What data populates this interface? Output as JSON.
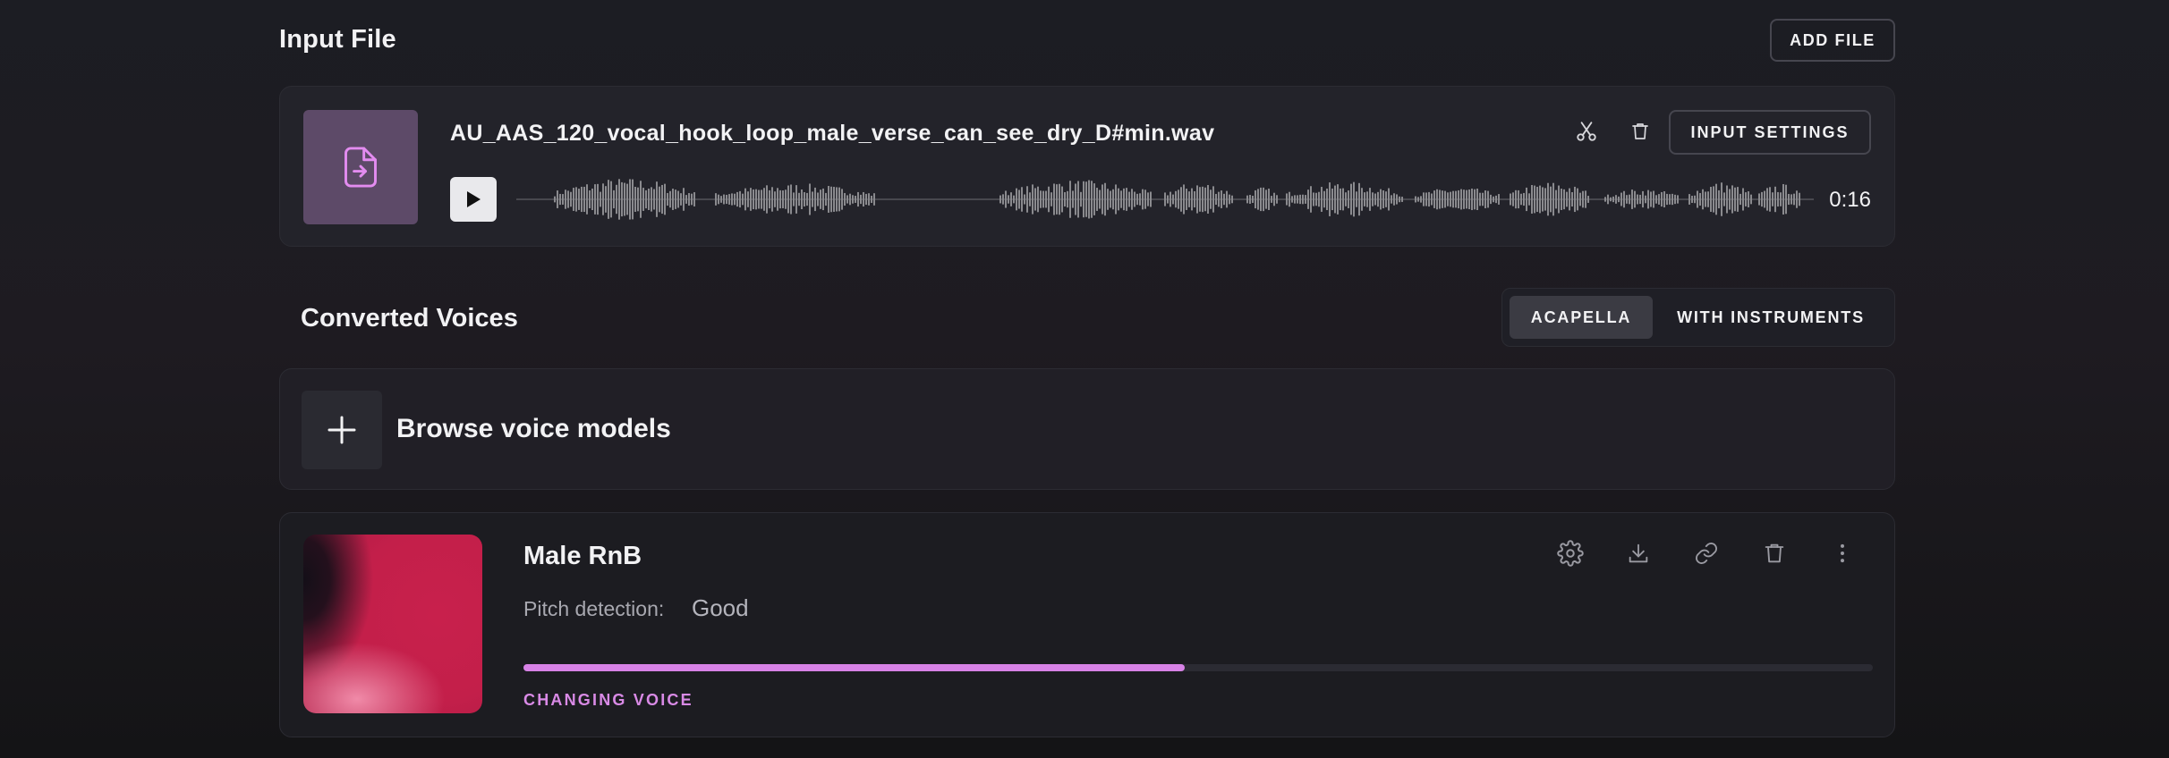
{
  "input_section": {
    "title": "Input File",
    "add_file_label": "ADD FILE"
  },
  "input_file": {
    "file_name": "AU_AAS_120_vocal_hook_loop_male_verse_can_see_dry_D#min.wav",
    "duration": "0:16",
    "input_settings_label": "INPUT SETTINGS",
    "icons": {
      "file": "file-import-icon",
      "trim": "scissors-icon",
      "delete": "trash-icon",
      "play": "play-icon"
    }
  },
  "converted_section": {
    "title": "Converted Voices",
    "tabs": [
      {
        "label": "ACAPELLA",
        "active": true
      },
      {
        "label": "WITH INSTRUMENTS",
        "active": false
      }
    ]
  },
  "browse": {
    "label": "Browse voice models",
    "icon": "plus-icon"
  },
  "voice": {
    "name": "Male RnB",
    "pitch_label": "Pitch detection:",
    "pitch_value": "Good",
    "progress_percent": 49,
    "status": "CHANGING VOICE",
    "icons": [
      "gear-icon",
      "download-icon",
      "link-icon",
      "trash-icon",
      "more-vertical-icon"
    ]
  },
  "colors": {
    "accent": "#d782e6",
    "file_tile": "#5d4a68",
    "art_primary": "#c8204c",
    "waveform": "#8a8a8e"
  }
}
